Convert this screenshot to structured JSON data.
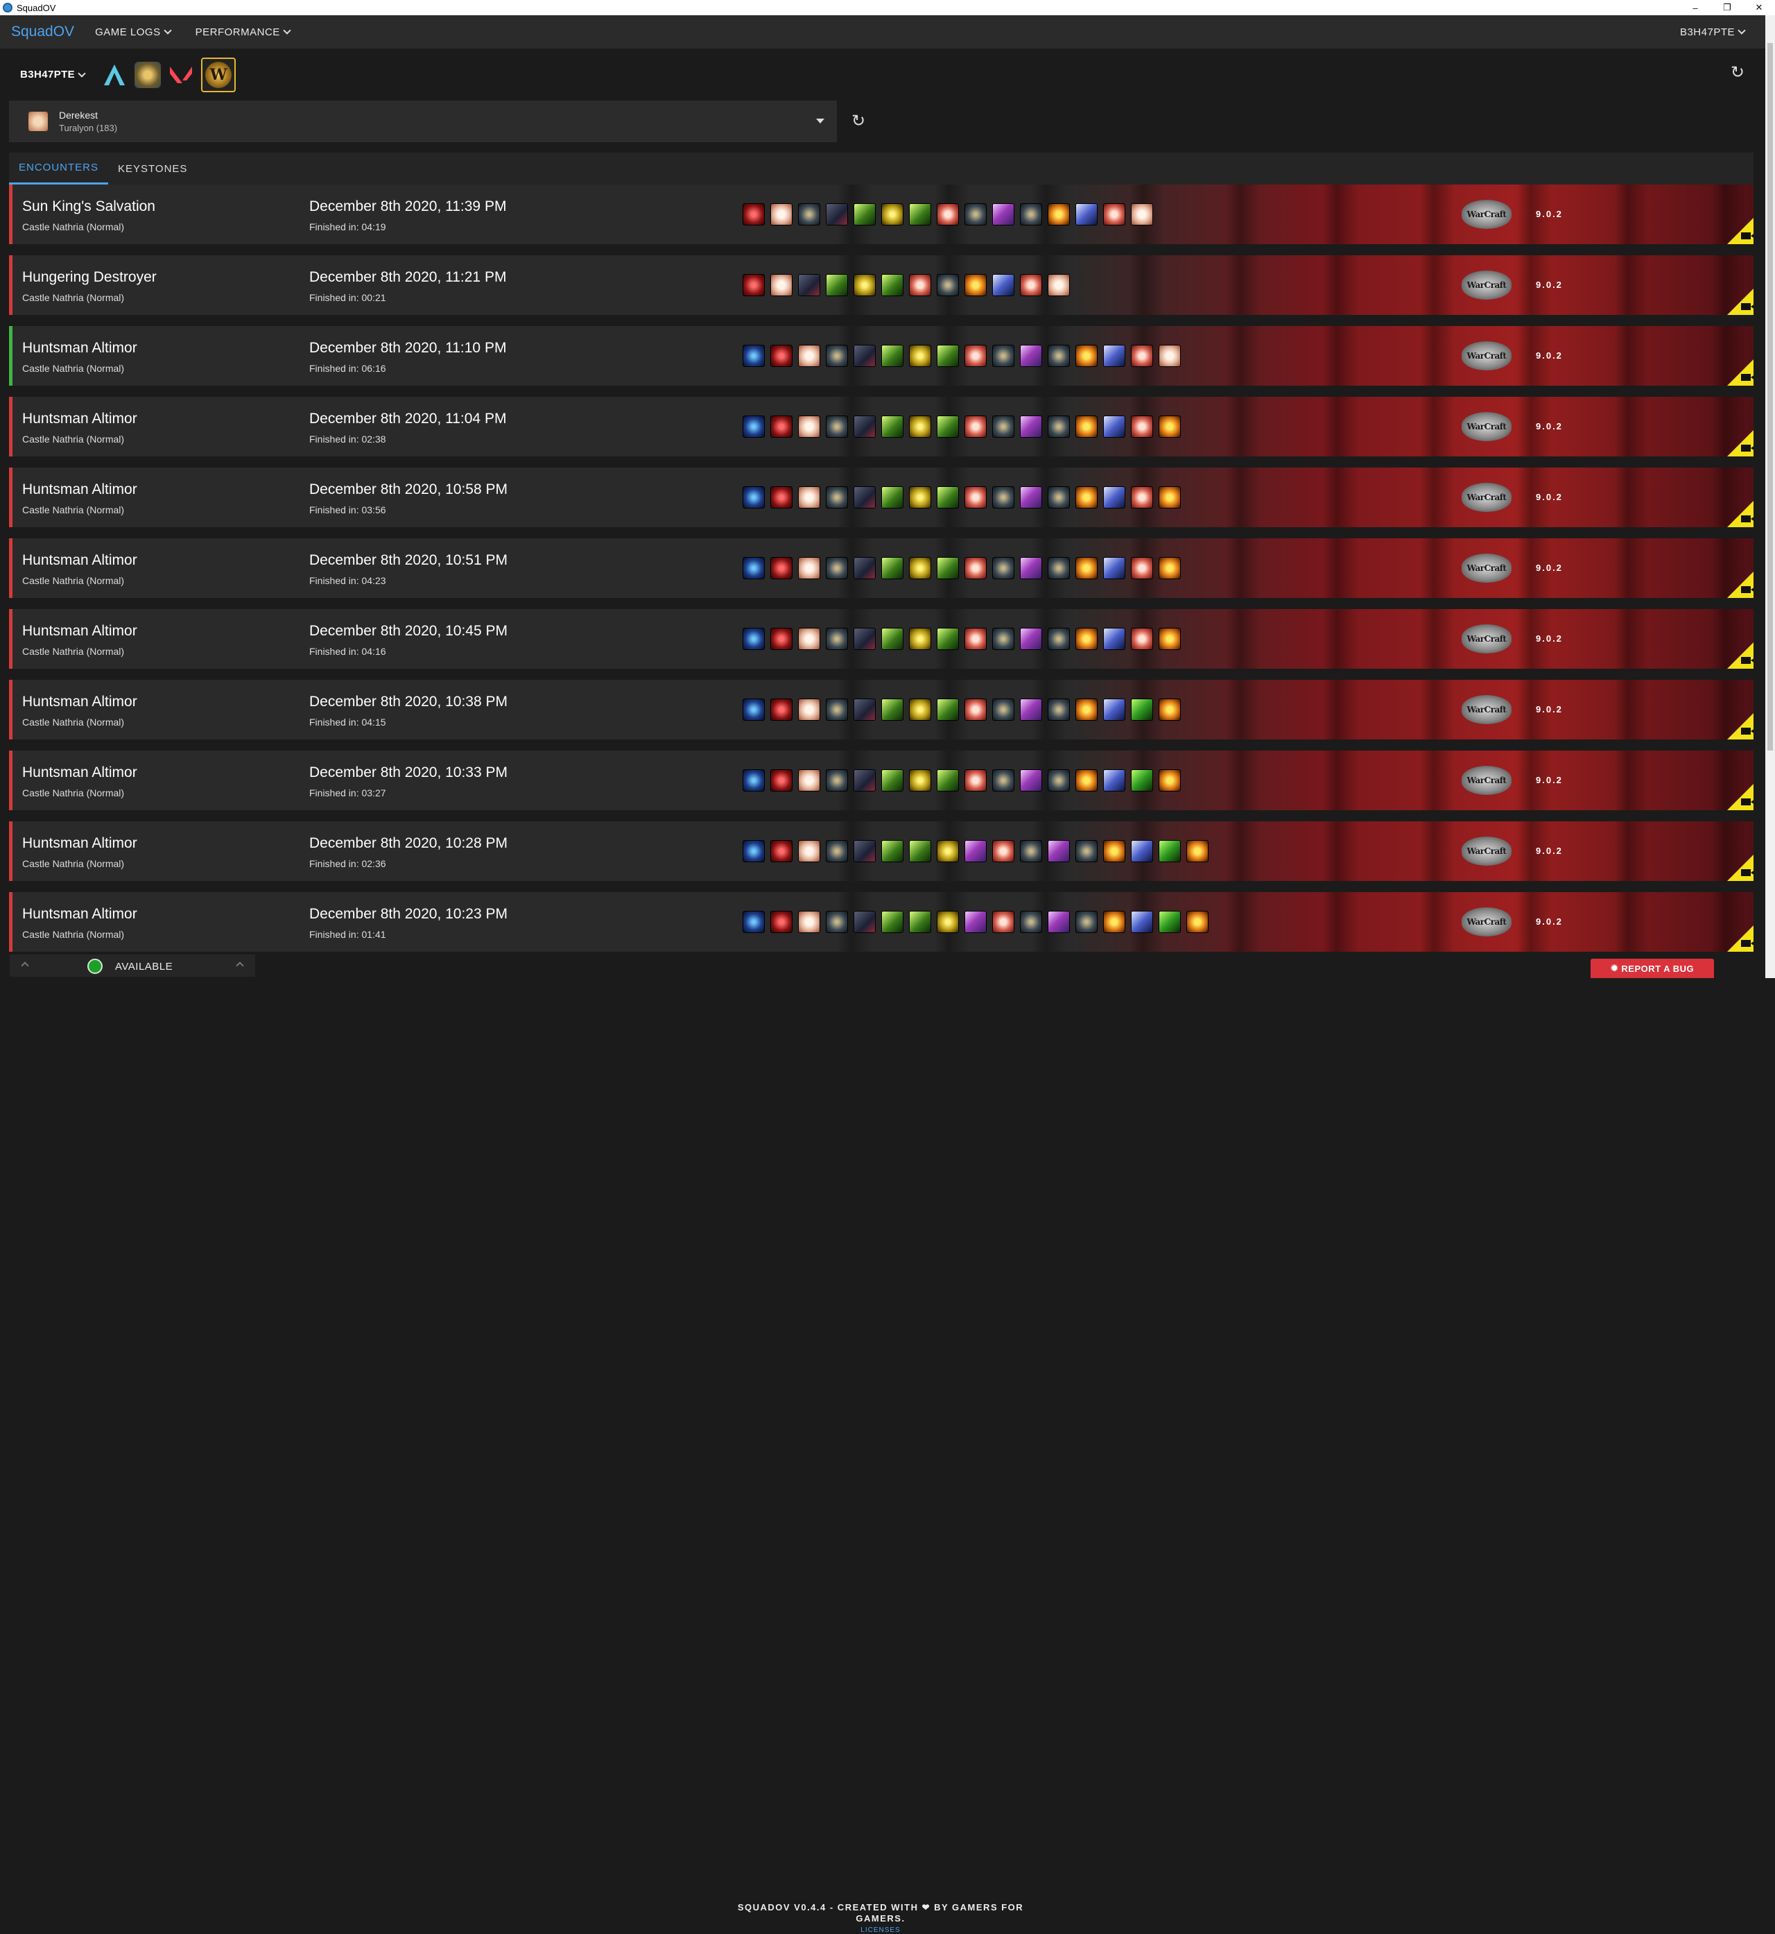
{
  "window": {
    "title": "SquadOV",
    "controls": [
      "–",
      "❐",
      "✕"
    ]
  },
  "nav": {
    "brand": "SquadOV",
    "menus": [
      "GAME LOGS",
      "PERFORMANCE"
    ],
    "user": "B3H47PTE"
  },
  "games": {
    "account": "B3H47PTE",
    "icons": [
      "aimlab-icon",
      "hearthstone-icon",
      "valorant-icon",
      "wow-icon"
    ],
    "selected": "wow-icon"
  },
  "character": {
    "name": "Derekest",
    "realm": "Turalyon (183)"
  },
  "tabs": [
    {
      "label": "ENCOUNTERS",
      "active": true
    },
    {
      "label": "KEYSTONES",
      "active": false
    }
  ],
  "encounters": [
    {
      "name": "Sun King's Salvation",
      "instance": "Castle Nathria (Normal)",
      "date": "December 8th 2020, 11:39 PM",
      "finished": "Finished in: 04:19",
      "result": "loss",
      "version": "9.0.2",
      "party": [
        "dk",
        "pal",
        "rog",
        "war",
        "hun",
        "mon",
        "hun",
        "dem",
        "rog",
        "mag",
        "rog",
        "wlk",
        "pri",
        "dem",
        "pal"
      ]
    },
    {
      "name": "Hungering Destroyer",
      "instance": "Castle Nathria (Normal)",
      "date": "December 8th 2020, 11:21 PM",
      "finished": "Finished in: 00:21",
      "result": "loss",
      "version": "9.0.2",
      "party": [
        "dk",
        "pal",
        "war",
        "hun",
        "mon",
        "hun",
        "dem",
        "rog",
        "wlk",
        "pri",
        "dem",
        "pal"
      ]
    },
    {
      "name": "Huntsman Altimor",
      "instance": "Castle Nathria (Normal)",
      "date": "December 8th 2020, 11:10 PM",
      "finished": "Finished in: 06:16",
      "result": "win",
      "version": "9.0.2",
      "party": [
        "sha",
        "dk",
        "pal",
        "rog",
        "war",
        "hun",
        "mon",
        "hun",
        "dem",
        "rog",
        "mag",
        "rog",
        "wlk",
        "pri",
        "dem",
        "pal"
      ]
    },
    {
      "name": "Huntsman Altimor",
      "instance": "Castle Nathria (Normal)",
      "date": "December 8th 2020, 11:04 PM",
      "finished": "Finished in: 02:38",
      "result": "loss",
      "version": "9.0.2",
      "party": [
        "sha",
        "dk",
        "pal",
        "rog",
        "war",
        "hun",
        "mon",
        "hun",
        "dem",
        "rog",
        "mag",
        "rog",
        "wlk",
        "pri",
        "dem",
        "wlk"
      ]
    },
    {
      "name": "Huntsman Altimor",
      "instance": "Castle Nathria (Normal)",
      "date": "December 8th 2020, 10:58 PM",
      "finished": "Finished in: 03:56",
      "result": "loss",
      "version": "9.0.2",
      "party": [
        "sha",
        "dk",
        "pal",
        "rog",
        "war",
        "hun",
        "mon",
        "hun",
        "dem",
        "rog",
        "mag",
        "rog",
        "wlk",
        "pri",
        "dem",
        "wlk"
      ]
    },
    {
      "name": "Huntsman Altimor",
      "instance": "Castle Nathria (Normal)",
      "date": "December 8th 2020, 10:51 PM",
      "finished": "Finished in: 04:23",
      "result": "loss",
      "version": "9.0.2",
      "party": [
        "sha",
        "dk",
        "pal",
        "rog",
        "war",
        "hun",
        "mon",
        "hun",
        "dem",
        "rog",
        "mag",
        "rog",
        "wlk",
        "pri",
        "dem",
        "wlk"
      ]
    },
    {
      "name": "Huntsman Altimor",
      "instance": "Castle Nathria (Normal)",
      "date": "December 8th 2020, 10:45 PM",
      "finished": "Finished in: 04:16",
      "result": "loss",
      "version": "9.0.2",
      "party": [
        "sha",
        "dk",
        "pal",
        "rog",
        "war",
        "hun",
        "mon",
        "hun",
        "dem",
        "rog",
        "mag",
        "rog",
        "wlk",
        "pri",
        "dem",
        "wlk"
      ]
    },
    {
      "name": "Huntsman Altimor",
      "instance": "Castle Nathria (Normal)",
      "date": "December 8th 2020, 10:38 PM",
      "finished": "Finished in: 04:15",
      "result": "loss",
      "version": "9.0.2",
      "party": [
        "sha",
        "dk",
        "pal",
        "rog",
        "war",
        "hun",
        "mon",
        "hun",
        "dem",
        "rog",
        "mag",
        "rog",
        "wlk",
        "pri",
        "evo",
        "wlk"
      ]
    },
    {
      "name": "Huntsman Altimor",
      "instance": "Castle Nathria (Normal)",
      "date": "December 8th 2020, 10:33 PM",
      "finished": "Finished in: 03:27",
      "result": "loss",
      "version": "9.0.2",
      "party": [
        "sha",
        "dk",
        "pal",
        "rog",
        "war",
        "hun",
        "mon",
        "hun",
        "dem",
        "rog",
        "mag",
        "rog",
        "wlk",
        "pri",
        "evo",
        "wlk"
      ]
    },
    {
      "name": "Huntsman Altimor",
      "instance": "Castle Nathria (Normal)",
      "date": "December 8th 2020, 10:28 PM",
      "finished": "Finished in: 02:36",
      "result": "loss",
      "version": "9.0.2",
      "party": [
        "sha",
        "dk",
        "pal",
        "rog",
        "war",
        "hun",
        "hun",
        "mon",
        "mag",
        "dem",
        "rog",
        "mag",
        "rog",
        "wlk",
        "pri",
        "evo",
        "wlk"
      ]
    },
    {
      "name": "Huntsman Altimor",
      "instance": "Castle Nathria (Normal)",
      "date": "December 8th 2020, 10:23 PM",
      "finished": "Finished in: 01:41",
      "result": "loss",
      "version": "9.0.2",
      "party": [
        "sha",
        "dk",
        "pal",
        "rog",
        "war",
        "hun",
        "hun",
        "mon",
        "mag",
        "dem",
        "rog",
        "mag",
        "rog",
        "wlk",
        "pri",
        "evo",
        "wlk"
      ]
    }
  ],
  "status": {
    "label": "AVAILABLE",
    "color": "#1f9e2a"
  },
  "footer": {
    "version": "SQUADOV V0.4.4 - CREATED WITH ❤ BY GAMERS FOR GAMERS.",
    "licenses": "LICENSES"
  },
  "bug_button": "REPORT A BUG",
  "colors": {
    "accent": "#4da3f0",
    "loss": "#d23b3b",
    "win": "#3fb546",
    "vod": "#f4e21a"
  }
}
